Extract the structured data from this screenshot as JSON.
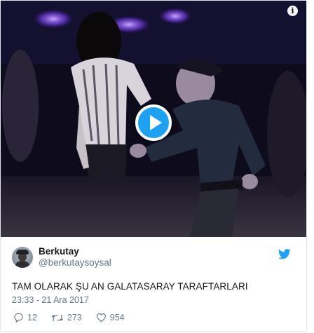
{
  "video": {
    "info_glyph": "i",
    "play_icon": "play-icon"
  },
  "tweet": {
    "display_name": "Berkutay",
    "handle": "@berkutaysoysal",
    "text": "TAM OLARAK ŞU AN GALATASARAY TARAFTARLARI",
    "timestamp": "23:33 - 21 Ara 2017"
  },
  "actions": {
    "replies": "12",
    "retweets": "273",
    "likes": "954"
  },
  "icons": {
    "brand": "twitter-bird-icon",
    "reply": "reply-icon",
    "retweet": "retweet-icon",
    "like": "heart-icon"
  },
  "colors": {
    "accent": "#1da1f2",
    "secondary_text": "#657786",
    "primary_text": "#14171a",
    "border": "#e1e8ed"
  }
}
